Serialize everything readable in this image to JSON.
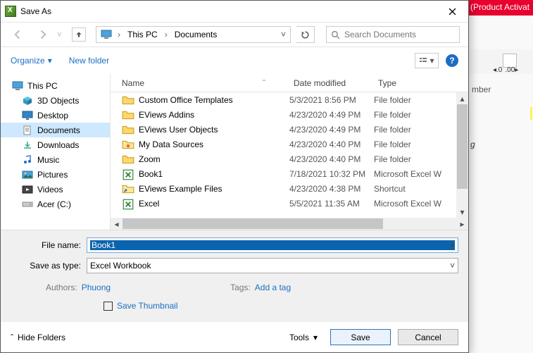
{
  "background": {
    "activation_banner": "(Product Activat",
    "row_label": "mber",
    "letter": "g"
  },
  "dialog": {
    "title": "Save As",
    "nav": {
      "crumb_root": "This PC",
      "crumb_current": "Documents",
      "search_placeholder": "Search Documents"
    },
    "toolbar": {
      "organize": "Organize",
      "new_folder": "New folder"
    },
    "sidebar": {
      "items": [
        {
          "label": "This PC",
          "icon": "pc"
        },
        {
          "label": "3D Objects",
          "icon": "3d"
        },
        {
          "label": "Desktop",
          "icon": "desktop"
        },
        {
          "label": "Documents",
          "icon": "documents",
          "selected": true
        },
        {
          "label": "Downloads",
          "icon": "downloads"
        },
        {
          "label": "Music",
          "icon": "music"
        },
        {
          "label": "Pictures",
          "icon": "pictures"
        },
        {
          "label": "Videos",
          "icon": "videos"
        },
        {
          "label": "Acer (C:)",
          "icon": "drive"
        }
      ]
    },
    "columns": {
      "name": "Name",
      "date": "Date modified",
      "type": "Type"
    },
    "files": [
      {
        "name": "Custom Office Templates",
        "date": "5/3/2021 8:56 PM",
        "type": "File folder",
        "icon": "folder"
      },
      {
        "name": "EViews Addins",
        "date": "4/23/2020 4:49 PM",
        "type": "File folder",
        "icon": "folder"
      },
      {
        "name": "EViews User Objects",
        "date": "4/23/2020 4:49 PM",
        "type": "File folder",
        "icon": "folder"
      },
      {
        "name": "My Data Sources",
        "date": "4/23/2020 4:40 PM",
        "type": "File folder",
        "icon": "datasrc"
      },
      {
        "name": "Zoom",
        "date": "4/23/2020 4:40 PM",
        "type": "File folder",
        "icon": "folder"
      },
      {
        "name": "Book1",
        "date": "7/18/2021 10:32 PM",
        "type": "Microsoft Excel W",
        "icon": "excel"
      },
      {
        "name": "EViews Example Files",
        "date": "4/23/2020 4:38 PM",
        "type": "Shortcut",
        "icon": "shortcut"
      },
      {
        "name": "Excel",
        "date": "5/5/2021 11:35 AM",
        "type": "Microsoft Excel W",
        "icon": "excel"
      }
    ],
    "form": {
      "file_name_label": "File name:",
      "file_name_value": "Book1",
      "save_type_label": "Save as type:",
      "save_type_value": "Excel Workbook",
      "authors_label": "Authors:",
      "authors_value": "Phuong",
      "tags_label": "Tags:",
      "tags_value": "Add a tag",
      "thumbnail_label": "Save Thumbnail"
    },
    "buttons": {
      "hide_folders": "Hide Folders",
      "tools": "Tools",
      "save": "Save",
      "cancel": "Cancel"
    }
  }
}
